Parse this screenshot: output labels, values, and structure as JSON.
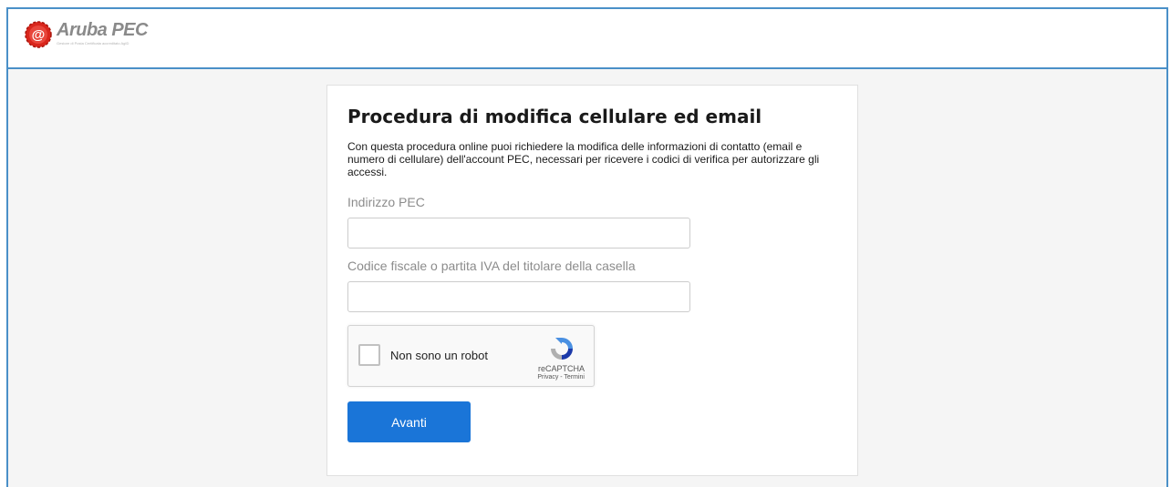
{
  "header": {
    "logo_text": "Aruba PEC",
    "logo_subtitle": "Gestore di Posta Certificata accreditato AgID"
  },
  "form": {
    "title": "Procedura di modifica cellulare ed email",
    "intro": "Con questa procedura online puoi richiedere la modifica delle informazioni di contatto (email e numero di cellulare) dell'account PEC, necessari per ricevere i codici di verifica per autorizzare gli accessi.",
    "pec_label": "Indirizzo PEC",
    "pec_value": "",
    "cf_label": "Codice fiscale o partita IVA del titolare della casella",
    "cf_value": "",
    "submit_label": "Avanti"
  },
  "recaptcha": {
    "checkbox_label": "Non sono un robot",
    "brand": "reCAPTCHA",
    "links": "Privacy - Termini"
  },
  "colors": {
    "accent": "#1a75d8",
    "frame": "#4a90c8",
    "logo_red": "#d9261c"
  }
}
